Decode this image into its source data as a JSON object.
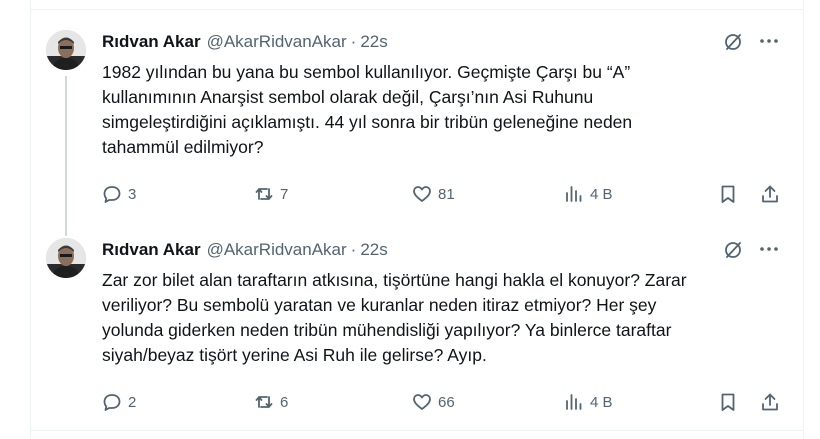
{
  "tweets": [
    {
      "author_name": "Rıdvan Akar",
      "handle": "@AkarRidvanAkar",
      "separator": "·",
      "time": "22s",
      "text": "1982 yılından bu yana bu sembol kullanılıyor. Geçmişte Çarşı bu “A”\nkullanımının Anarşist sembol olarak değil, Çarşı’nın Asi Ruhunu\nsimgeleştirdiğini açıklamıştı. 44 yıl sonra bir tribün geleneğine neden\ntahammül edilmiyor?",
      "replies": "3",
      "reposts": "7",
      "likes": "81",
      "views": "4 B"
    },
    {
      "author_name": "Rıdvan Akar",
      "handle": "@AkarRidvanAkar",
      "separator": "·",
      "time": "22s",
      "text": "Zar zor bilet alan taraftarın atkısına, tişörtüne hangi hakla el konuyor? Zarar\nveriliyor? Bu sembolü yaratan ve kuranlar neden itiraz etmiyor? Her şey\nyolunda giderken neden tribün mühendisliği yapılıyor? Ya binlerce taraftar\nsiyah/beyaz tişört yerine Asi Ruh ile gelirse? Ayıp.",
      "replies": "2",
      "reposts": "6",
      "likes": "66",
      "views": "4 B"
    }
  ],
  "icons": {
    "grok": "grok-icon",
    "more": "more-icon",
    "reply": "reply-icon",
    "repost": "repost-icon",
    "like": "heart-icon",
    "views": "views-icon",
    "bookmark": "bookmark-icon",
    "share": "share-icon"
  },
  "colors": {
    "text": "#0f1419",
    "secondary": "#536471",
    "border": "#eff3f4",
    "thread_line": "#cfd9de"
  }
}
